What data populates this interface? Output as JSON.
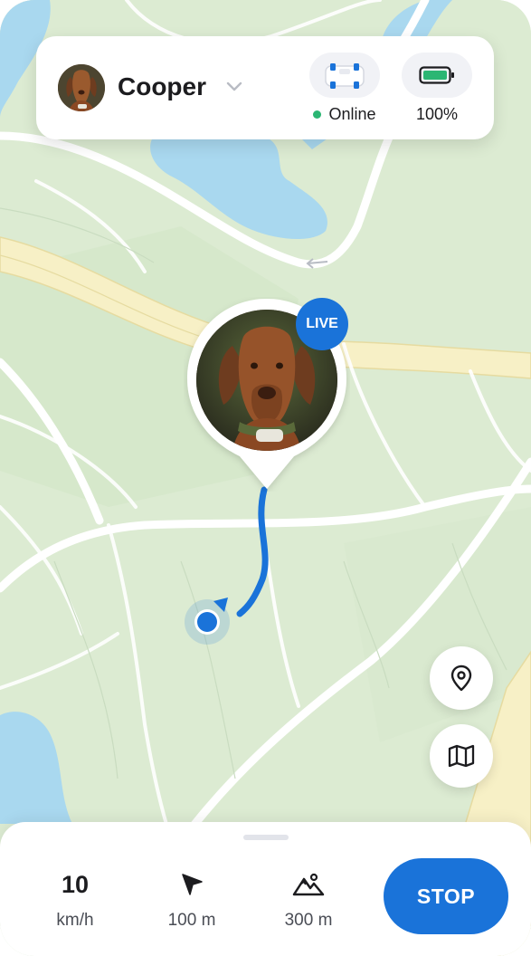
{
  "pet": {
    "name": "Cooper"
  },
  "tracker": {
    "status_label": "Online",
    "status_color": "#2bb673",
    "battery_label": "100%",
    "battery_level": 1.0,
    "battery_color": "#2bb673"
  },
  "map": {
    "live_label": "LIVE",
    "accent_color": "#1a73d9"
  },
  "controls": {
    "locate_icon": "location-pin-icon",
    "map_type_icon": "map-icon"
  },
  "stats": {
    "speed_value": "10",
    "speed_unit": "km/h",
    "direction_icon": "navigation-arrow-icon",
    "distance_label": "100 m",
    "terrain_icon": "mountain-icon",
    "elevation_label": "300 m"
  },
  "actions": {
    "stop_label": "STOP"
  }
}
